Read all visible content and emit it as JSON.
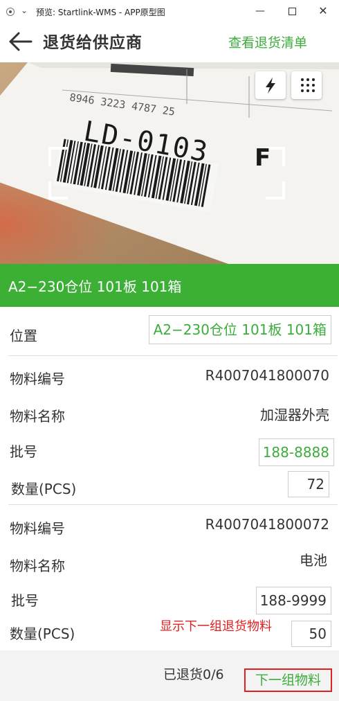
{
  "window": {
    "title": "预览: Startlink-WMS - APP原型图",
    "minimize_glyph": "—",
    "close_glyph": "✕"
  },
  "header": {
    "title": "退货给供应商",
    "action": "查看退货清单"
  },
  "camera": {
    "icons": [
      "flash-icon",
      "menu-dots-icon"
    ],
    "scanned_label_text": "LD-0103",
    "label_top_text": "8946   3223 4787 25",
    "label_side_letter": "F"
  },
  "location_banner": "A2−230仓位 101板 101箱",
  "form": {
    "location_label": "位置",
    "location_value": "A2−230仓位 101板 101箱",
    "items": [
      {
        "code_label": "物料编号",
        "code": "R4007041800070",
        "name_label": "物料名称",
        "name": "加湿器外壳",
        "batch_label": "批号",
        "batch": "188-8888",
        "qty_label": "数量(PCS)",
        "qty": "72"
      },
      {
        "code_label": "物料编号",
        "code": "R4007041800072",
        "name_label": "物料名称",
        "name": "电池",
        "batch_label": "批号",
        "batch": "188-9999",
        "qty_label": "数量(PCS)",
        "qty": "50"
      }
    ],
    "hint": "显示下一组退货物料"
  },
  "footer": {
    "returned": "已退货0/6",
    "next_button": "下一组物料"
  },
  "colors": {
    "accent_green": "#3cb035",
    "text_green": "#3cad3c",
    "hint_red": "#e02020"
  }
}
